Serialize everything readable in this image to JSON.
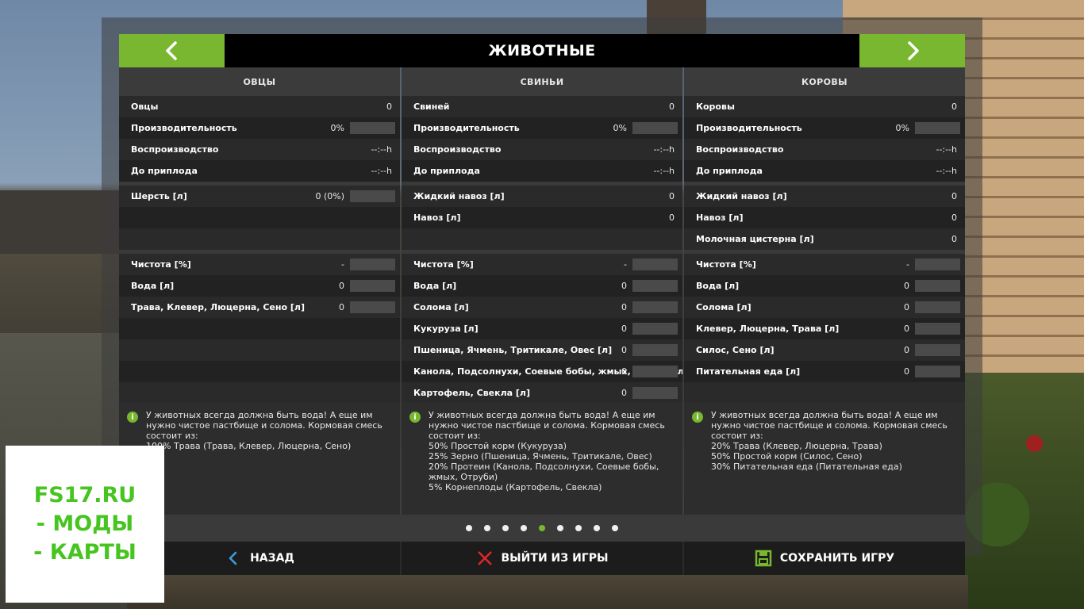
{
  "title": "ЖИВОТНЫЕ",
  "columns": [
    {
      "header": "ОВЦЫ",
      "rows": [
        {
          "label": "Овцы",
          "value": "0",
          "bar": false
        },
        {
          "label": "Производительность",
          "value": "0%",
          "bar": true
        },
        {
          "label": "Воспроизводство",
          "value": "--:--h",
          "bar": false
        },
        {
          "label": "До приплода",
          "value": "--:--h",
          "bar": false
        }
      ],
      "rows2": [
        {
          "label": "Шерсть [л]",
          "value": "0 (0%)",
          "bar": true
        },
        {
          "label": "",
          "value": "",
          "bar": false
        },
        {
          "label": "",
          "value": "",
          "bar": false
        }
      ],
      "rows3": [
        {
          "label": "Чистота [%]",
          "value": "-",
          "bar": true
        },
        {
          "label": "Вода [л]",
          "value": "0",
          "bar": true
        },
        {
          "label": "Трава, Клевер, Люцерна, Сено [л]",
          "value": "0",
          "bar": true
        },
        {
          "label": "",
          "value": "",
          "bar": false
        },
        {
          "label": "",
          "value": "",
          "bar": false
        },
        {
          "label": "",
          "value": "",
          "bar": false
        },
        {
          "label": "",
          "value": "",
          "bar": false
        }
      ],
      "info": "У животных всегда должна быть вода! А еще им нужно чистое пастбище и солома. Кормовая смесь состоит из:\n100% Трава (Трава, Клевер, Люцерна, Сено)"
    },
    {
      "header": "СВИНЬИ",
      "rows": [
        {
          "label": "Свиней",
          "value": "0",
          "bar": false
        },
        {
          "label": "Производительность",
          "value": "0%",
          "bar": true
        },
        {
          "label": "Воспроизводство",
          "value": "--:--h",
          "bar": false
        },
        {
          "label": "До приплода",
          "value": "--:--h",
          "bar": false
        }
      ],
      "rows2": [
        {
          "label": "Жидкий навоз [л]",
          "value": "0",
          "bar": false
        },
        {
          "label": "Навоз [л]",
          "value": "0",
          "bar": false
        },
        {
          "label": "",
          "value": "",
          "bar": false
        }
      ],
      "rows3": [
        {
          "label": "Чистота [%]",
          "value": "-",
          "bar": true
        },
        {
          "label": "Вода [л]",
          "value": "0",
          "bar": true
        },
        {
          "label": "Солома [л]",
          "value": "0",
          "bar": true
        },
        {
          "label": "Кукуруза [л]",
          "value": "0",
          "bar": true
        },
        {
          "label": "Пшеница, Ячмень, Тритикале, Овес [л]",
          "value": "0",
          "bar": true
        },
        {
          "label": "Канола, Подсолнухи, Соевые бобы, жмых, Отруби [л]",
          "value": "0",
          "bar": true
        },
        {
          "label": "Картофель, Свекла [л]",
          "value": "0",
          "bar": true
        }
      ],
      "info": "У животных всегда должна быть вода! А еще им нужно чистое пастбище и солома. Кормовая смесь состоит из:\n50% Простой корм (Кукуруза)\n25% Зерно (Пшеница, Ячмень, Тритикале, Овес)\n20% Протеин (Канола, Подсолнухи, Соевые бобы, жмых, Отруби)\n5% Корнеплоды (Картофель, Свекла)"
    },
    {
      "header": "КОРОВЫ",
      "rows": [
        {
          "label": "Коровы",
          "value": "0",
          "bar": false
        },
        {
          "label": "Производительность",
          "value": "0%",
          "bar": true
        },
        {
          "label": "Воспроизводство",
          "value": "--:--h",
          "bar": false
        },
        {
          "label": "До приплода",
          "value": "--:--h",
          "bar": false
        }
      ],
      "rows2": [
        {
          "label": "Жидкий навоз [л]",
          "value": "0",
          "bar": false
        },
        {
          "label": "Навоз [л]",
          "value": "0",
          "bar": false
        },
        {
          "label": "Молочная цистерна [л]",
          "value": "0",
          "bar": false
        }
      ],
      "rows3": [
        {
          "label": "Чистота [%]",
          "value": "-",
          "bar": true
        },
        {
          "label": "Вода [л]",
          "value": "0",
          "bar": true
        },
        {
          "label": "Солома [л]",
          "value": "0",
          "bar": true
        },
        {
          "label": "Клевер, Люцерна, Трава [л]",
          "value": "0",
          "bar": true
        },
        {
          "label": "Силос, Сено [л]",
          "value": "0",
          "bar": true
        },
        {
          "label": "Питательная еда [л]",
          "value": "0",
          "bar": true
        },
        {
          "label": "",
          "value": "",
          "bar": false
        }
      ],
      "info": "У животных всегда должна быть вода! А еще им нужно чистое пастбище и солома. Кормовая смесь состоит из:\n20% Трава (Клевер, Люцерна, Трава)\n50% Простой корм (Силос, Сено)\n30% Питательная еда (Питательная еда)"
    }
  ],
  "pager": {
    "count": 9,
    "active_index": 4
  },
  "footer": {
    "back_label": "НАЗАД",
    "exit_label": "ВЫЙТИ ИЗ ИГРЫ",
    "save_label": "СОХРАНИТЬ ИГРУ"
  },
  "watermark": {
    "line1": "FS17.RU",
    "line2": "- МОДЫ",
    "line3": "- КАРТЫ"
  },
  "colors": {
    "accent": "#78b72f",
    "exit_icon": "#e0262a",
    "back_icon": "#3aa0e0"
  },
  "icons": {
    "prev": "chevron-left-icon",
    "next": "chevron-right-icon",
    "back": "back-arrow-icon",
    "exit": "close-icon",
    "save": "save-icon",
    "info": "info-icon"
  }
}
